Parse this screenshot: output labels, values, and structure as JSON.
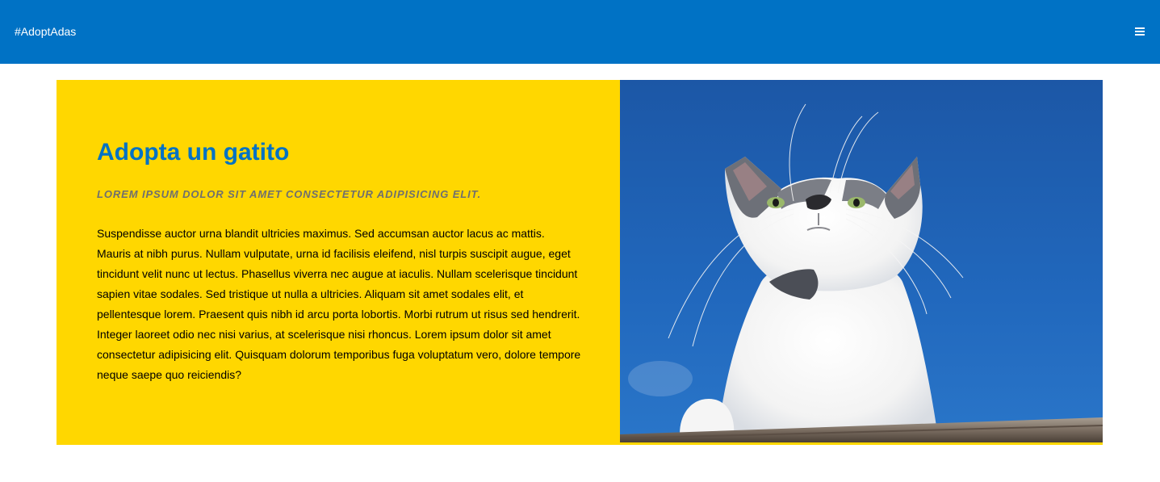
{
  "header": {
    "brand": "#AdoptAdas",
    "menu_icon": "hamburger-menu-icon"
  },
  "feature": {
    "title": "Adopta un gatito",
    "subtitle": "LOREM IPSUM DOLOR SIT AMET CONSECTETUR ADIPISICING ELIT.",
    "body": "Suspendisse auctor urna blandit ultricies maximus. Sed accumsan auctor lacus ac mattis. Mauris at nibh purus. Nullam vulputate, urna id facilisis eleifend, nisl turpis suscipit augue, eget tincidunt velit nunc ut lectus. Phasellus viverra nec augue at iaculis. Nullam scelerisque tincidunt sapien vitae sodales. Sed tristique ut nulla a ultricies. Aliquam sit amet sodales elit, et pellentesque lorem. Praesent quis nibh id arcu porta lobortis. Morbi rutrum ut risus sed hendrerit. Integer laoreet odio nec nisi varius, at scelerisque nisi rhoncus. Lorem ipsum dolor sit amet consectetur adipisicing elit. Quisquam dolorum temporibus fuga voluptatum vero, dolore tempore neque saepe quo reiciendis?",
    "image_icon": "cat-photo"
  },
  "colors": {
    "header_bg": "#0072c5",
    "card_bg": "#ffd700",
    "title": "#0072c5",
    "subtitle": "#6f6f6f",
    "sky": "#1f62b5"
  }
}
